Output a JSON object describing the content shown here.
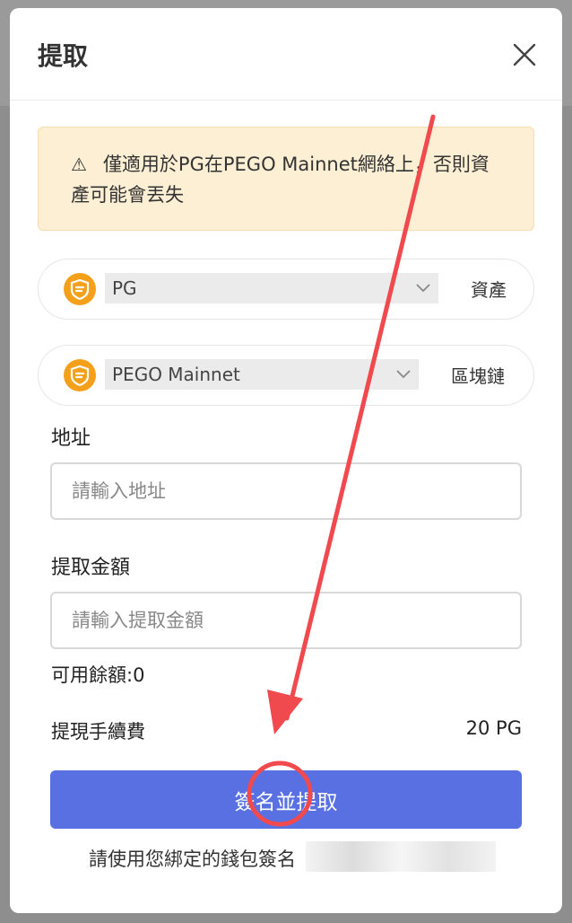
{
  "modal": {
    "title": "提取",
    "warning": "僅適用於PG在PEGO Mainnet網絡上，否則資產可能會丟失",
    "asset_select": {
      "value": "PG",
      "side_label": "資產"
    },
    "chain_select": {
      "value": "PEGO Mainnet",
      "side_label": "區塊鏈"
    },
    "address": {
      "label": "地址",
      "placeholder": "請輸入地址",
      "value": ""
    },
    "amount": {
      "label": "提取金額",
      "placeholder": "請輸入提取金額",
      "value": ""
    },
    "balance": "可用餘額:0",
    "fee": {
      "label": "提現手續費",
      "value": "20 PG"
    },
    "submit_label": "簽名並提取",
    "hint": "請使用您綁定的錢包簽名"
  },
  "icons": {
    "close": "close-icon",
    "warning": "warning-triangle-icon",
    "coin": "pego-coin-icon",
    "chevron": "chevron-down-icon"
  },
  "colors": {
    "accent": "#5870e2",
    "warning_bg": "#fdefd4",
    "coin_orange": "#f5a01a",
    "annotation_red": "#f04a4e"
  }
}
